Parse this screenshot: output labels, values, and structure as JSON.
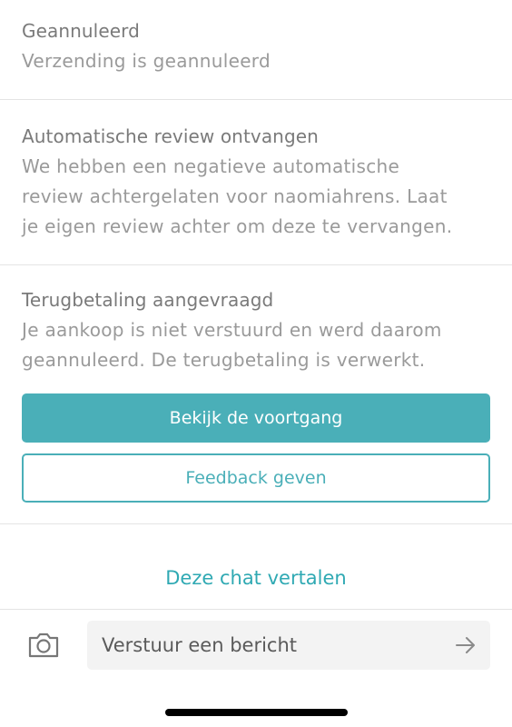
{
  "events": [
    {
      "title": "Geannuleerd",
      "lines": [
        "Verzending is geannuleerd"
      ]
    },
    {
      "title": "Automatische review ontvangen",
      "lines": [
        "We hebben een negatieve automatische",
        "review achtergelaten voor naomiahrens. Laat",
        "je eigen review achter om deze te vervangen."
      ]
    },
    {
      "title": "Terugbetaling aangevraagd",
      "lines": [
        "Je aankoop is niet verstuurd en werd daarom",
        "geannuleerd. De terugbetaling is verwerkt."
      ]
    }
  ],
  "buttons": {
    "progress": "Bekijk de voortgang",
    "feedback": "Feedback geven"
  },
  "translate_link": "Deze chat vertalen",
  "composer": {
    "placeholder": "Verstuur een bericht",
    "camera_icon": "camera-icon",
    "send_icon": "arrow-right-icon"
  },
  "colors": {
    "accent": "#4aafb8",
    "link": "#2fa9b3",
    "title_text": "#7a7a7a",
    "body_text": "#9a9a9a"
  }
}
